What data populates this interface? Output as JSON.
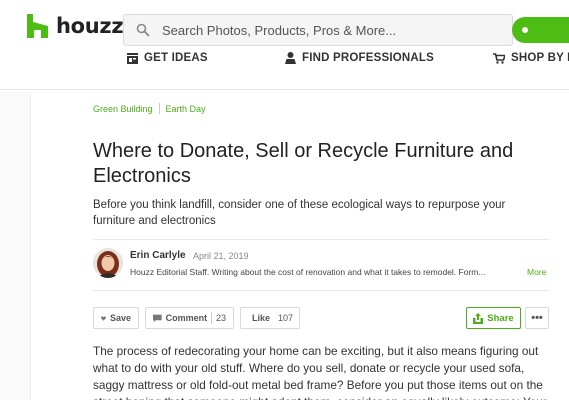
{
  "header": {
    "logo_text": "houzz",
    "search_placeholder": "Search Photos, Products, Pros & More...",
    "accent_color": "#4dbc15"
  },
  "nav": {
    "items": [
      {
        "label": "GET IDEAS",
        "icon": "ideas-icon"
      },
      {
        "label": "FIND PROFESSIONALS",
        "icon": "pro-icon"
      },
      {
        "label": "SHOP BY D",
        "icon": "cart-icon"
      }
    ]
  },
  "article": {
    "breadcrumbs": [
      "Green Building",
      "Earth Day"
    ],
    "title": "Where to Donate, Sell or Recycle Furniture and Electronics",
    "subtitle": "Before you think landfill, consider one of these ecological ways to repurpose your furniture and electronics",
    "author": {
      "name": "Erin Carlyle",
      "date": "April 21, 2019",
      "bio": "Houzz Editorial Staff. Writing about the cost of renovation and what it takes to remodel. Form...",
      "more_label": "More"
    },
    "actions": {
      "save_label": "Save",
      "comment_label": "Comment",
      "comment_count": "23",
      "like_label": "Like",
      "like_count": "107",
      "share_label": "Share",
      "more_label": "•••"
    },
    "body": "The process of redecorating your home can be exciting, but it also means figuring out what to do with your old stuff. Where do you sell, donate or recycle your used sofa, saggy mattress or old fold-out metal bed frame? Before you put those items out on the street hoping that someone might adopt them, consider an equally likely outcome: Your"
  }
}
